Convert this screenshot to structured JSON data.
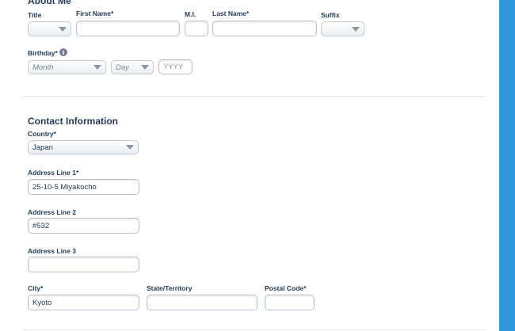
{
  "about": {
    "heading": "About Me",
    "title_label": "Title",
    "first_name_label": "First Name",
    "mi_label": "M.I.",
    "last_name_label": "Last Name",
    "suffix_label": "Suffix",
    "title_value": "",
    "first_name_value": "",
    "mi_value": "",
    "last_name_value": "",
    "suffix_value": "",
    "birthday_label": "Birthday",
    "birthday_info_icon": "info-icon",
    "month_placeholder": "Month",
    "day_placeholder": "Day",
    "year_placeholder": "YYYY"
  },
  "contact": {
    "heading": "Contact Information",
    "country_label": "Country",
    "country_value": "Japan",
    "address1_label": "Address Line 1",
    "address1_value": "25-10-5 Miyakocho",
    "address2_label": "Address Line 2",
    "address2_value": "#532",
    "address3_label": "Address Line 3",
    "address3_value": "",
    "city_label": "City",
    "city_value": "Kyoto",
    "state_label": "State/Territory",
    "state_value": "",
    "postal_label": "Postal Code",
    "postal_value": ""
  },
  "colors": {
    "accent_side": "#2f97db",
    "text": "#253b56"
  }
}
